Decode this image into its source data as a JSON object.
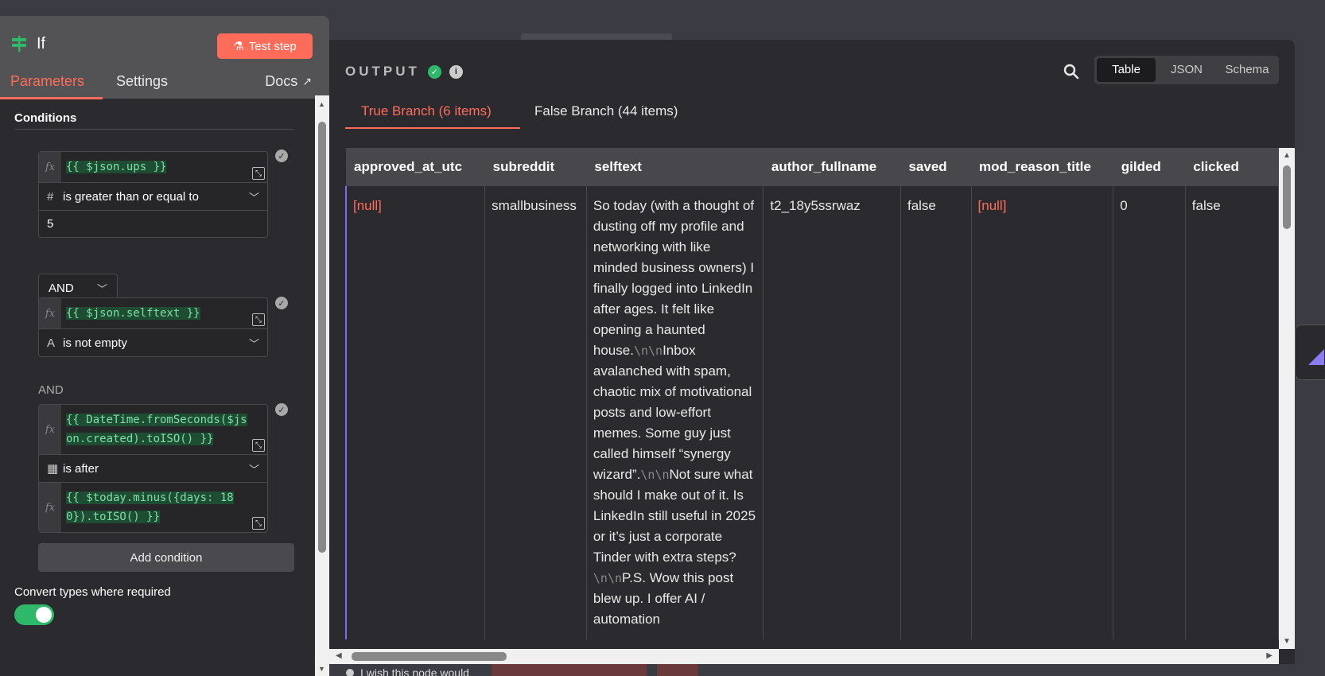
{
  "node": {
    "title": "If",
    "test_button": "Test step",
    "tabs": [
      "Parameters",
      "Settings"
    ],
    "docs": "Docs",
    "section_title": "Conditions",
    "conditions": [
      {
        "expr": "{{ $json.ups }}",
        "type_icon": "#",
        "operator": "is greater than or equal to",
        "value": "5"
      },
      {
        "expr": "{{ $json.selftext }}",
        "type_icon": "A",
        "operator": "is not empty"
      },
      {
        "expr_line1": "{{ DateTime.fromSeconds($js",
        "expr_line2": "on.created).toISO() }}",
        "operator": "is after",
        "value_line1": "{{ $today.minus({days: 18",
        "value_line2": "0}).toISO() }}"
      }
    ],
    "combinator": "AND",
    "and_label": "AND",
    "add_condition": "Add condition",
    "convert_types_label": "Convert types where required",
    "fx": "fx"
  },
  "output": {
    "title": "OUTPUT",
    "view_options": [
      "Table",
      "JSON",
      "Schema"
    ],
    "active_view": "Table",
    "branches": {
      "true": "True Branch (6 items)",
      "false": "False Branch (44 items)"
    },
    "columns": [
      "approved_at_utc",
      "subreddit",
      "selftext",
      "author_fullname",
      "saved",
      "mod_reason_title",
      "gilded",
      "clicked"
    ],
    "row": {
      "approved_at_utc": "[null]",
      "subreddit": "smallbusiness",
      "selftext_parts": [
        {
          "t": "So today (with a thought of dusting off my profile and networking with like minded business owners) I finally logged into LinkedIn after ages. It felt like opening a haunted house."
        },
        {
          "e": "\\n\\n"
        },
        {
          "t": "Inbox avalanched with spam, chaotic mix of motivational posts and low-effort memes. Some guy just called himself “synergy wizard”."
        },
        {
          "e": "\\n\\n"
        },
        {
          "t": "Not sure what should I make out of it. Is LinkedIn still useful in 2025 or it’s just a corporate Tinder with extra steps?"
        },
        {
          "e": "\\n\\n"
        },
        {
          "t": "P.S. Wow this post blew up. I offer AI / automation"
        }
      ],
      "author_fullname": "t2_18y5ssrwaz",
      "saved": "false",
      "mod_reason_title": "[null]",
      "gilded": "0",
      "clicked": "false"
    }
  },
  "bottom_hint": "I wish this node would",
  "colors": {
    "accent": "#ff6d5a",
    "success": "#2db86a",
    "expr_bg": "#1f4d34",
    "expr_fg": "#7de0a5"
  }
}
